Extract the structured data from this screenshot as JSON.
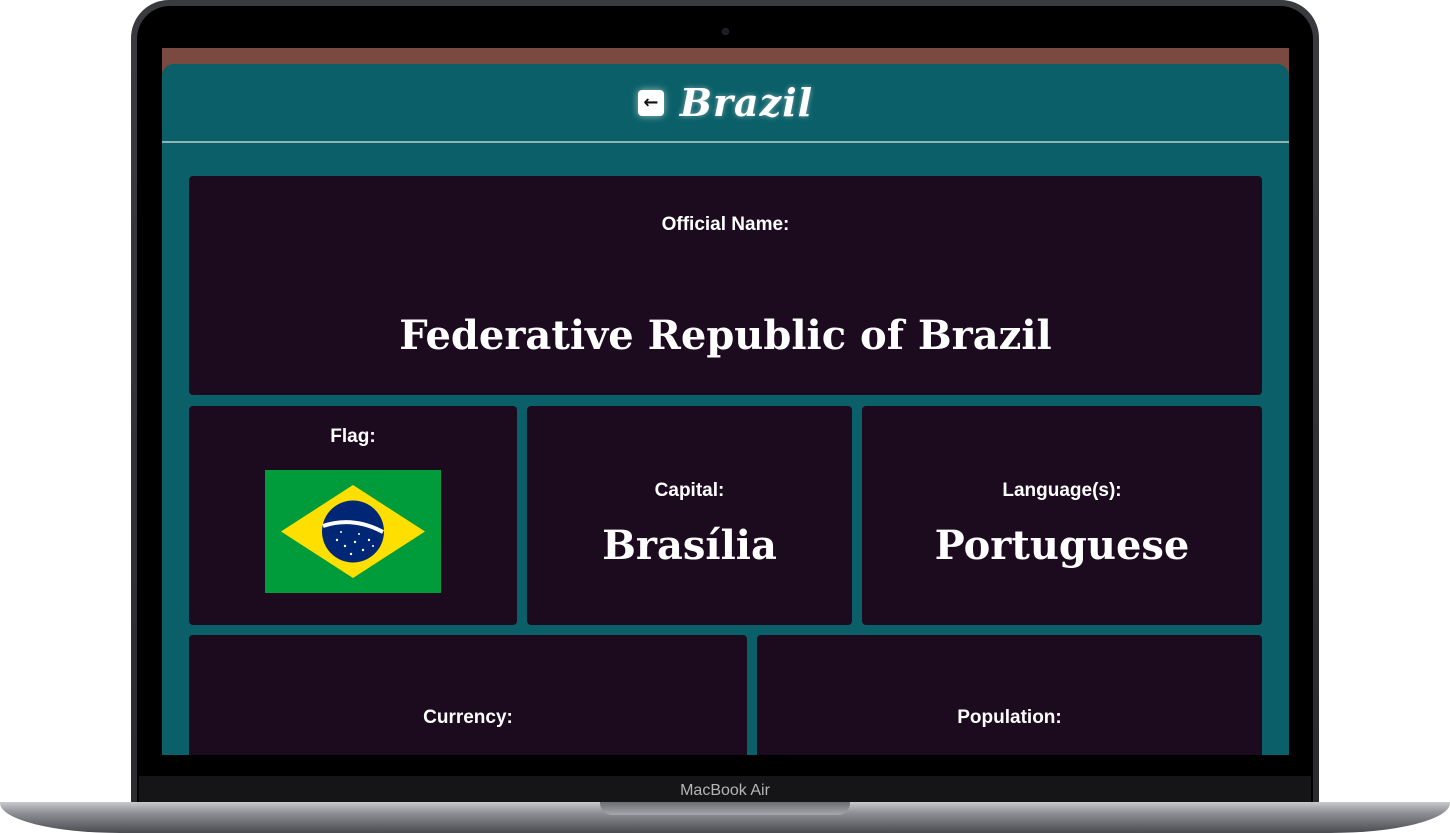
{
  "device": {
    "label": "MacBook Air"
  },
  "header": {
    "back_icon": "arrow-left-icon",
    "back_glyph": "←",
    "title": "Brazil"
  },
  "official_name": {
    "label": "Official Name:",
    "value": "Federative Republic of Brazil"
  },
  "flag": {
    "label": "Flag:",
    "icon": "brazil-flag-icon"
  },
  "capital": {
    "label": "Capital:",
    "value": "Brasília"
  },
  "languages": {
    "label": "Language(s):",
    "value": "Portuguese"
  },
  "currency": {
    "label": "Currency:"
  },
  "population": {
    "label": "Population:"
  },
  "colors": {
    "app_background": "#0a5f68",
    "card_background": "#1c0a1f",
    "text": "#ffffff"
  }
}
